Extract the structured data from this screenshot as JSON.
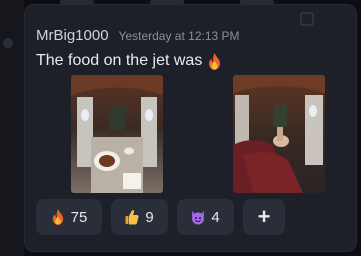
{
  "message": {
    "username": "MrBig1000",
    "timestamp": "Yesterday at 12:13 PM",
    "text": "The food on the jet was",
    "text_emoji": "fire-icon"
  },
  "images": [
    {
      "name": "jet-interior-food-photo"
    },
    {
      "name": "jet-interior-photo"
    }
  ],
  "reactions": [
    {
      "emoji": "fire-icon",
      "count": "75"
    },
    {
      "emoji": "thumbs-up-icon",
      "count": "9"
    },
    {
      "emoji": "devil-icon",
      "count": "4"
    },
    {
      "emoji": "plus-icon",
      "label": "+"
    }
  ],
  "colors": {
    "background": "#0e0e12",
    "panel": "#1d2028",
    "reaction_bg": "#2a2e38",
    "username": "#cfd3dc",
    "timestamp": "#8a8f9a",
    "text": "#e8eaef"
  }
}
